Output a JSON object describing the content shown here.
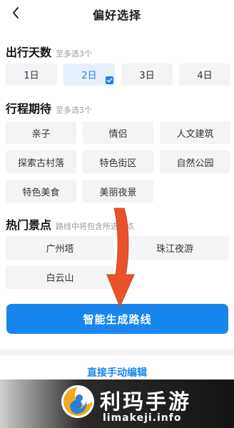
{
  "header": {
    "title": "偏好选择"
  },
  "days": {
    "title": "出行天数",
    "hint": "至多选3个",
    "options": [
      "1日",
      "2日",
      "3日",
      "4日"
    ],
    "selected": "2日"
  },
  "expectations": {
    "title": "行程期待",
    "hint": "至多选3个",
    "options": [
      "亲子",
      "情侣",
      "人文建筑",
      "探索古村落",
      "特色街区",
      "自然公园",
      "特色美食",
      "美丽夜景"
    ]
  },
  "attractions": {
    "title": "热门景点",
    "hint": "路线中将包含所选景点",
    "options": [
      "广州塔",
      "珠江夜游",
      "白云山"
    ]
  },
  "actions": {
    "generate": "智能生成路线",
    "manual": "直接手动编辑"
  },
  "watermark": {
    "title": "利玛手游",
    "site": "limakeji.info"
  },
  "colors": {
    "accent": "#1886ee",
    "arrow": "#e8532c",
    "chip": "#f3f4f6",
    "selected_chip": "#e6f0fd"
  }
}
